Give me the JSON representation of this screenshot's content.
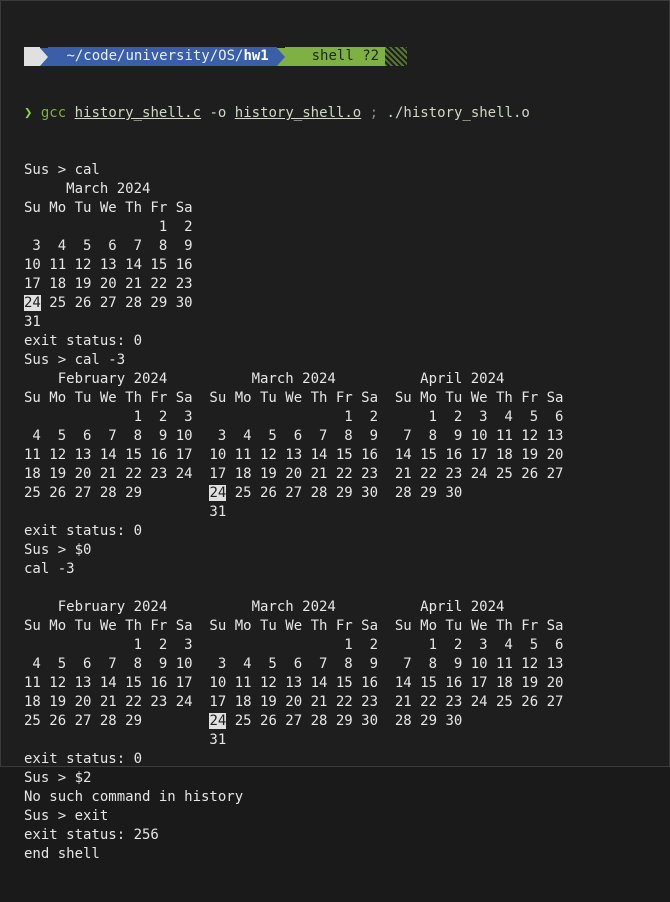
{
  "prompt": {
    "os_icon": "",
    "dir_icon": "",
    "dir_path": "~/code/university/OS/",
    "dir_current": "hw1",
    "git_icons": " ",
    "git_branch": "shell",
    "git_status": "?2"
  },
  "command": {
    "chevron": "❯",
    "cmd": "gcc",
    "src": "history_shell.c",
    "flag": "-o",
    "out": "history_shell.o",
    "sep": ";",
    "run": "./history_shell.o"
  },
  "output": [
    {
      "t": "Sus > cal"
    },
    {
      "t": "     March 2024"
    },
    {
      "t": "Su Mo Tu We Th Fr Sa"
    },
    {
      "t": "                1  2"
    },
    {
      "t": " 3  4  5  6  7  8  9"
    },
    {
      "t": "10 11 12 13 14 15 16"
    },
    {
      "t": "17 18 19 20 21 22 23"
    },
    {
      "pre": "",
      "hl": "24",
      "post": " 25 26 27 28 29 30"
    },
    {
      "t": "31"
    },
    {
      "t": "exit status: 0"
    },
    {
      "t": "Sus > cal -3"
    },
    {
      "t": "    February 2024          March 2024          April 2024"
    },
    {
      "t": "Su Mo Tu We Th Fr Sa  Su Mo Tu We Th Fr Sa  Su Mo Tu We Th Fr Sa"
    },
    {
      "t": "             1  2  3                  1  2      1  2  3  4  5  6"
    },
    {
      "t": " 4  5  6  7  8  9 10   3  4  5  6  7  8  9   7  8  9 10 11 12 13"
    },
    {
      "t": "11 12 13 14 15 16 17  10 11 12 13 14 15 16  14 15 16 17 18 19 20"
    },
    {
      "t": "18 19 20 21 22 23 24  17 18 19 20 21 22 23  21 22 23 24 25 26 27"
    },
    {
      "pre": "25 26 27 28 29        ",
      "hl": "24",
      "post": " 25 26 27 28 29 30  28 29 30"
    },
    {
      "t": "                      31"
    },
    {
      "t": "exit status: 0"
    },
    {
      "t": "Sus > $0"
    },
    {
      "t": "cal -3"
    },
    {
      "t": ""
    },
    {
      "t": "    February 2024          March 2024          April 2024"
    },
    {
      "t": "Su Mo Tu We Th Fr Sa  Su Mo Tu We Th Fr Sa  Su Mo Tu We Th Fr Sa"
    },
    {
      "t": "             1  2  3                  1  2      1  2  3  4  5  6"
    },
    {
      "t": " 4  5  6  7  8  9 10   3  4  5  6  7  8  9   7  8  9 10 11 12 13"
    },
    {
      "t": "11 12 13 14 15 16 17  10 11 12 13 14 15 16  14 15 16 17 18 19 20"
    },
    {
      "t": "18 19 20 21 22 23 24  17 18 19 20 21 22 23  21 22 23 24 25 26 27"
    },
    {
      "pre": "25 26 27 28 29        ",
      "hl": "24",
      "post": " 25 26 27 28 29 30  28 29 30"
    },
    {
      "t": "                      31"
    },
    {
      "t": "exit status: 0"
    },
    {
      "t": "Sus > $2"
    },
    {
      "t": "No such command in history"
    },
    {
      "t": "Sus > exit"
    },
    {
      "t": "exit status: 256"
    },
    {
      "t": "end shell"
    }
  ],
  "colors": {
    "background": "#1e1e1e",
    "text": "#e6e6e6",
    "dir_segment": "#3a5fa8",
    "git_segment": "#7fb043",
    "highlight": "#e0e0e0"
  }
}
